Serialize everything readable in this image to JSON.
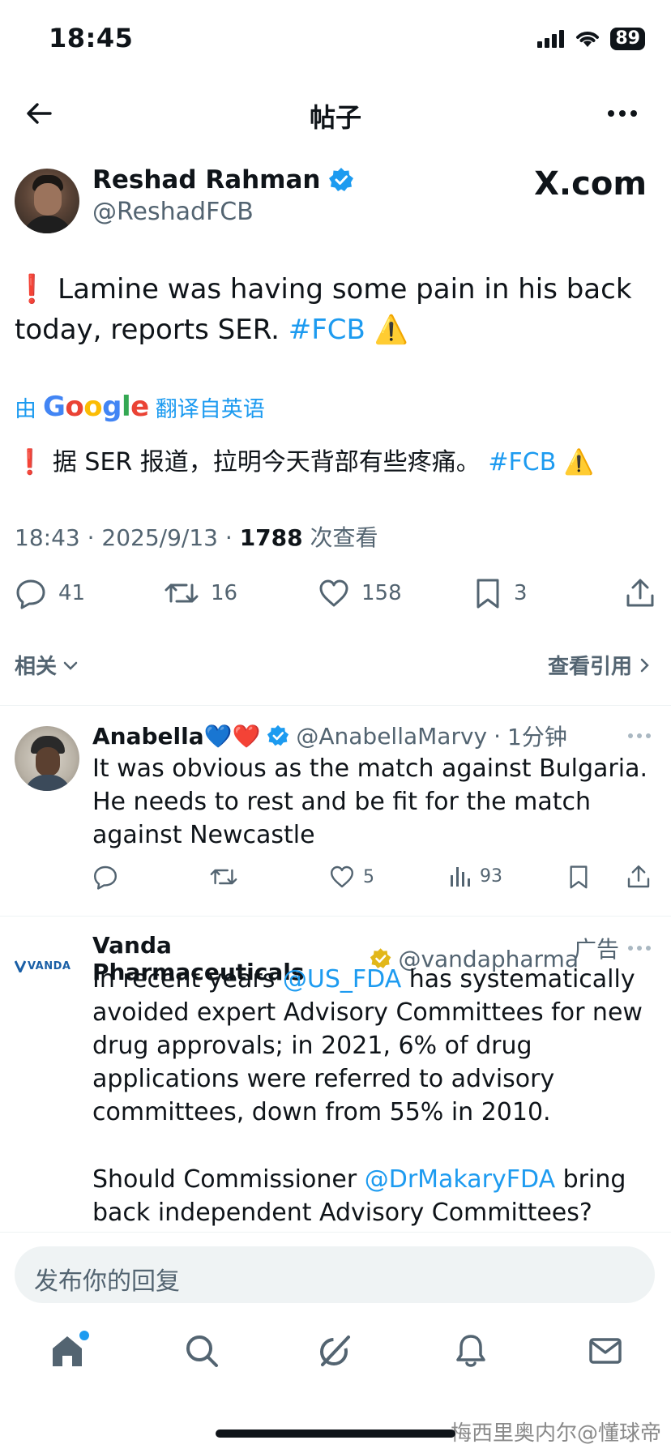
{
  "status": {
    "time": "18:45",
    "battery": "89"
  },
  "topbar": {
    "title": "帖子"
  },
  "tweet": {
    "author_name": "Reshad Rahman",
    "author_handle": "@ReshadFCB",
    "source_label": "X.com",
    "text_prefix": "❗ Lamine was having some pain in his back today, reports SER. ",
    "hashtag": "#FCB",
    "text_suffix": " ⚠️",
    "translate_by": "由",
    "translate_brand": "Google",
    "translate_label": "翻译自英语",
    "translated_prefix": "❗ 据 SER 报道，拉明今天背部有些疼痛。",
    "translated_hashtag": "#FCB",
    "translated_suffix": " ⚠️",
    "time": "18:43",
    "date": "2025/9/13",
    "views": "1788",
    "views_label": "次查看",
    "replies": "41",
    "retweets": "16",
    "likes": "158",
    "bookmarks": "3"
  },
  "related": {
    "label": "相关",
    "quotes_label": "查看引用"
  },
  "reply1": {
    "name": "Anabella💙❤️",
    "handle": "@AnabellaMarvy",
    "sep": "·",
    "time": "1分钟",
    "text": "It was obvious as the match against Bulgaria. He needs to rest and be fit for the match against Newcastle",
    "likes": "5",
    "views": "93"
  },
  "ad": {
    "name": "Vanda Pharmaceuticals",
    "handle": "@vandapharma",
    "ad_label": "广告",
    "logo_text": "VANDA",
    "p1_a": "In recent years ",
    "p1_mention": "@US_FDA",
    "p1_b": " has systematically avoided expert Advisory Committees for new drug approvals; in 2021, 6% of drug applications were referred to advisory committees, down from 55% in 2010.",
    "p2_a": "Should Commissioner ",
    "p2_mention": "@DrMakaryFDA",
    "p2_b": " bring back independent Advisory Committees?"
  },
  "compose": {
    "placeholder": "发布你的回复"
  },
  "watermark": "梅西里奥内尔@懂球帝",
  "colors": {
    "accent": "#1d9bf0",
    "secondary_text": "#536471",
    "gold_badge": "#e2b719"
  },
  "icons": [
    "back-arrow-icon",
    "more-icon",
    "verified-icon",
    "reply-icon",
    "retweet-icon",
    "like-icon",
    "bookmark-icon",
    "share-icon",
    "views-icon",
    "home-icon",
    "search-icon",
    "grok-icon",
    "bell-icon",
    "mail-icon"
  ]
}
